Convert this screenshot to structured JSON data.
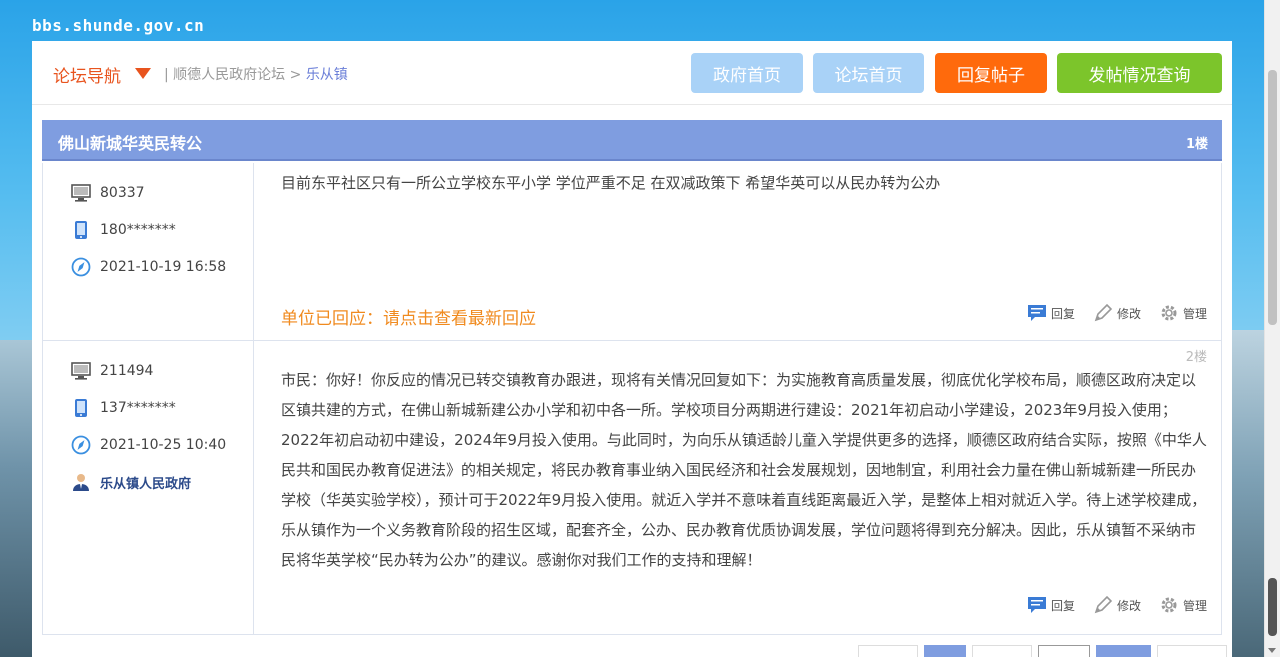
{
  "site": {
    "domain": "bbs.shunde.gov.cn"
  },
  "nav": {
    "title": "论坛导航",
    "breadcrumb_separator": "|",
    "breadcrumb_root": "顺德人民政府论坛",
    "breadcrumb_arrow": ">",
    "breadcrumb_current": "乐从镇",
    "buttons": {
      "gov_home": "政府首页",
      "forum_home": "论坛首页",
      "reply_post": "回复帖子",
      "post_status": "发帖情况查询"
    }
  },
  "thread": {
    "title": "佛山新城华英民转公",
    "floor_label": "1楼"
  },
  "posts": [
    {
      "id": "80337",
      "phone": "180*******",
      "datetime": "2021-10-19 16:58",
      "content": "目前东平社区只有一所公立学校东平小学 学位严重不足 在双减政策下 希望华英可以从民办转为公办",
      "official_reply_notice": "单位已回应：请点击查看最新回应",
      "actions": {
        "reply": "回复",
        "edit": "修改",
        "manage": "管理"
      }
    },
    {
      "floor": "2楼",
      "id": "211494",
      "phone": "137*******",
      "datetime": "2021-10-25 10:40",
      "unit": "乐从镇人民政府",
      "content": "市民：你好！你反应的情况已转交镇教育办跟进，现将有关情况回复如下：为实施教育高质量发展，彻底优化学校布局，顺德区政府决定以区镇共建的方式，在佛山新城新建公办小学和初中各一所。学校项目分两期进行建设：2021年初启动小学建设，2023年9月投入使用；2022年初启动初中建设，2024年9月投入使用。与此同时，为向乐从镇适龄儿童入学提供更多的选择，顺德区政府结合实际，按照《中华人民共和国民办教育促进法》的相关规定，将民办教育事业纳入国民经济和社会发展规划，因地制宜，利用社会力量在佛山新城新建一所民办学校（华英实验学校），预计可于2022年9月投入使用。就近入学并不意味着直线距离最近入学，是整体上相对就近入学。待上述学校建成，乐从镇作为一个义务教育阶段的招生区域，配套齐全，公办、民办教育优质协调发展，学位问题将得到充分解决。因此，乐从镇暂不采纳市民将华英学校“民办转为公办”的建议。感谢你对我们工作的支持和理解！",
      "actions": {
        "reply": "回复",
        "edit": "修改",
        "manage": "管理"
      }
    }
  ],
  "colors": {
    "nav_accent": "#e8541e",
    "header_bar": "#7f9de0",
    "reply_button": "#ff6a0c",
    "query_button": "#7cc52b",
    "home_buttons": "#a9d2f7",
    "official_notice": "#f08a1e"
  },
  "icons": {
    "id": "monitor-icon",
    "phone": "mobile-phone-icon",
    "time": "compass-icon",
    "unit": "official-user-icon",
    "reply": "speech-bubble-icon",
    "edit": "pencil-icon",
    "manage": "gear-icon"
  }
}
